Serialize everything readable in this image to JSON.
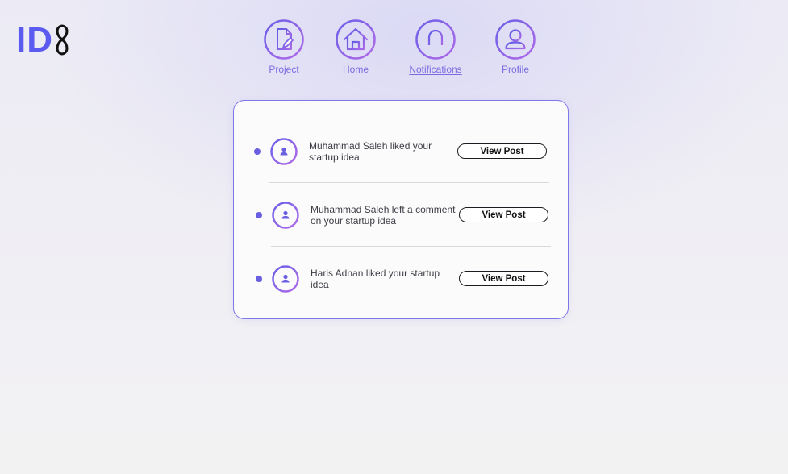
{
  "brand": {
    "logo_text": "ID",
    "accent_color": "#5b5bf0",
    "mark_color": "#111111"
  },
  "nav": {
    "items": [
      {
        "label": "Project",
        "icon": "document-edit-icon"
      },
      {
        "label": "Home",
        "icon": "home-icon"
      },
      {
        "label": "Notifications",
        "icon": "bell-icon",
        "active": true
      },
      {
        "label": "Profile",
        "icon": "user-icon"
      }
    ],
    "gradient_start": "#6a5fe8",
    "gradient_end": "#b26be8"
  },
  "notifications": [
    {
      "text": "Muhammad Saleh liked your startup idea",
      "button_label": "View Post",
      "avatar_icon": "user-icon",
      "unread": true
    },
    {
      "text": "Muhammad Saleh left a comment on your startup idea",
      "button_label": "View Post",
      "avatar_icon": "user-icon",
      "unread": true
    },
    {
      "text": "Haris Adnan liked your startup idea",
      "button_label": "View Post",
      "avatar_icon": "user-icon",
      "unread": true
    }
  ]
}
